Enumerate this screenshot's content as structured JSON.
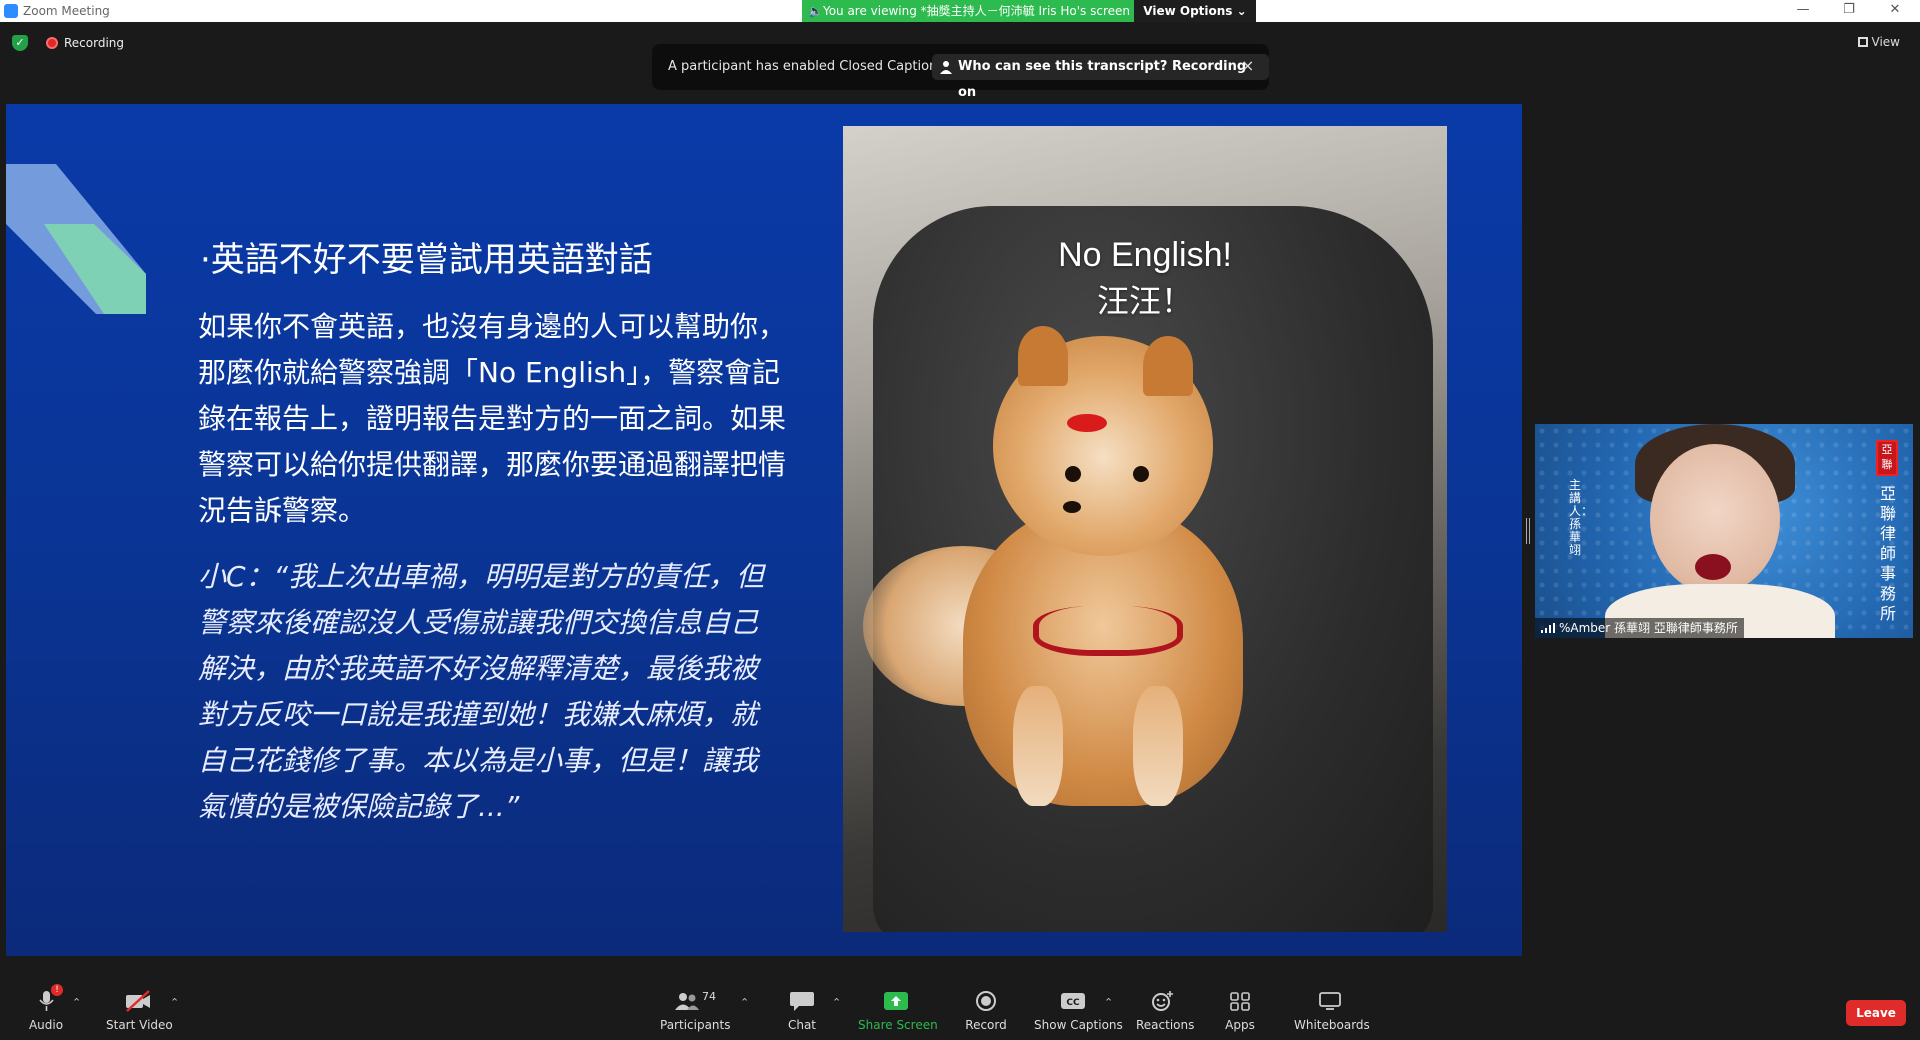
{
  "window": {
    "title": "Zoom Meeting",
    "viewing_banner": "You are viewing *抽獎主持人－何沛毓 Iris Ho's screen",
    "view_options_label": "View Options"
  },
  "topbar": {
    "recording_label": "Recording",
    "view_label": "View"
  },
  "caption_toast": {
    "message": "A participant has enabled Closed Captioning",
    "who_label": "Who can see this transcript? Recording on",
    "close_glyph": "×"
  },
  "slide": {
    "heading": "·英語不好不要嘗試用英語對話",
    "body": "如果你不會英語，也沒有身邊的人可以幫助你，那麼你就給警察強調「No English」，警察會記錄在報告上，證明報告是對方的一面之詞。如果警察可以給你提供翻譯，那麼你要通過翻譯把情況告訴警察。",
    "quote": "小C：“我上次出車禍，明明是對方的責任，但警察來後確認沒人受傷就讓我們交換信息自己解決，由於我英語不好沒解釋清楚，最後我被對方反咬一口說是我撞到她！我嫌太麻煩，就自己花錢修了事。本以為是小事，但是！讓我氣憤的是被保險記錄了...”",
    "photo_title_line1": "No English!",
    "photo_title_line2": "汪汪！"
  },
  "participant_video": {
    "name": "%Amber 孫華翊 亞聯律師事務所",
    "left_vertical_text": "主講人：孫華翊",
    "seal_text": "亞聯",
    "right_vertical_text": "亞聯律師事務所"
  },
  "toolbar": {
    "audio_label": "Audio",
    "audio_badge": "!",
    "video_label": "Start Video",
    "participants_label": "Participants",
    "participants_count": "74",
    "chat_label": "Chat",
    "share_label": "Share Screen",
    "record_label": "Record",
    "captions_label": "Show Captions",
    "reactions_label": "Reactions",
    "apps_label": "Apps",
    "whiteboards_label": "Whiteboards",
    "leave_label": "Leave"
  },
  "colors": {
    "share_green": "#2dba4e",
    "leave_red": "#e02b2b",
    "slide_blue": "#0a3aa8"
  }
}
